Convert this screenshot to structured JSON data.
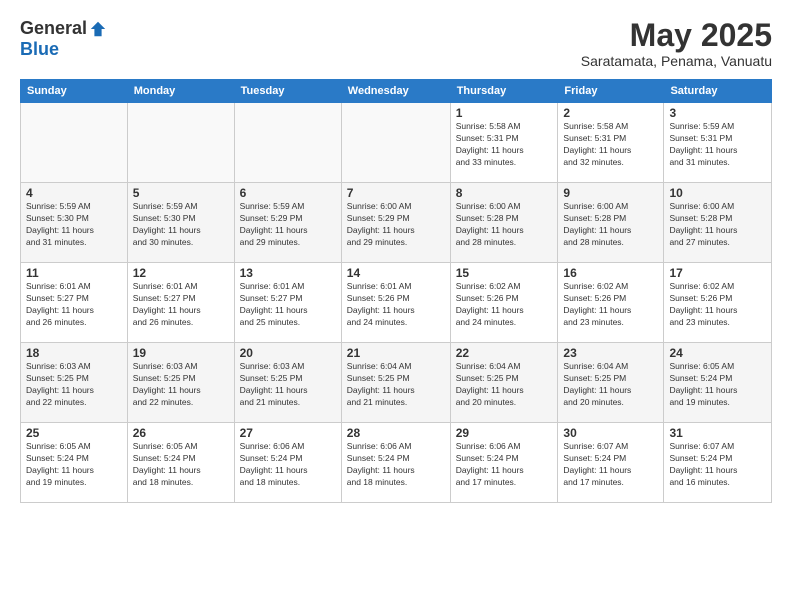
{
  "header": {
    "logo_general": "General",
    "logo_blue": "Blue",
    "month_title": "May 2025",
    "subtitle": "Saratamata, Penama, Vanuatu"
  },
  "days_of_week": [
    "Sunday",
    "Monday",
    "Tuesday",
    "Wednesday",
    "Thursday",
    "Friday",
    "Saturday"
  ],
  "weeks": [
    [
      {
        "day": "",
        "info": ""
      },
      {
        "day": "",
        "info": ""
      },
      {
        "day": "",
        "info": ""
      },
      {
        "day": "",
        "info": ""
      },
      {
        "day": "1",
        "info": "Sunrise: 5:58 AM\nSunset: 5:31 PM\nDaylight: 11 hours\nand 33 minutes."
      },
      {
        "day": "2",
        "info": "Sunrise: 5:58 AM\nSunset: 5:31 PM\nDaylight: 11 hours\nand 32 minutes."
      },
      {
        "day": "3",
        "info": "Sunrise: 5:59 AM\nSunset: 5:31 PM\nDaylight: 11 hours\nand 31 minutes."
      }
    ],
    [
      {
        "day": "4",
        "info": "Sunrise: 5:59 AM\nSunset: 5:30 PM\nDaylight: 11 hours\nand 31 minutes."
      },
      {
        "day": "5",
        "info": "Sunrise: 5:59 AM\nSunset: 5:30 PM\nDaylight: 11 hours\nand 30 minutes."
      },
      {
        "day": "6",
        "info": "Sunrise: 5:59 AM\nSunset: 5:29 PM\nDaylight: 11 hours\nand 29 minutes."
      },
      {
        "day": "7",
        "info": "Sunrise: 6:00 AM\nSunset: 5:29 PM\nDaylight: 11 hours\nand 29 minutes."
      },
      {
        "day": "8",
        "info": "Sunrise: 6:00 AM\nSunset: 5:28 PM\nDaylight: 11 hours\nand 28 minutes."
      },
      {
        "day": "9",
        "info": "Sunrise: 6:00 AM\nSunset: 5:28 PM\nDaylight: 11 hours\nand 28 minutes."
      },
      {
        "day": "10",
        "info": "Sunrise: 6:00 AM\nSunset: 5:28 PM\nDaylight: 11 hours\nand 27 minutes."
      }
    ],
    [
      {
        "day": "11",
        "info": "Sunrise: 6:01 AM\nSunset: 5:27 PM\nDaylight: 11 hours\nand 26 minutes."
      },
      {
        "day": "12",
        "info": "Sunrise: 6:01 AM\nSunset: 5:27 PM\nDaylight: 11 hours\nand 26 minutes."
      },
      {
        "day": "13",
        "info": "Sunrise: 6:01 AM\nSunset: 5:27 PM\nDaylight: 11 hours\nand 25 minutes."
      },
      {
        "day": "14",
        "info": "Sunrise: 6:01 AM\nSunset: 5:26 PM\nDaylight: 11 hours\nand 24 minutes."
      },
      {
        "day": "15",
        "info": "Sunrise: 6:02 AM\nSunset: 5:26 PM\nDaylight: 11 hours\nand 24 minutes."
      },
      {
        "day": "16",
        "info": "Sunrise: 6:02 AM\nSunset: 5:26 PM\nDaylight: 11 hours\nand 23 minutes."
      },
      {
        "day": "17",
        "info": "Sunrise: 6:02 AM\nSunset: 5:26 PM\nDaylight: 11 hours\nand 23 minutes."
      }
    ],
    [
      {
        "day": "18",
        "info": "Sunrise: 6:03 AM\nSunset: 5:25 PM\nDaylight: 11 hours\nand 22 minutes."
      },
      {
        "day": "19",
        "info": "Sunrise: 6:03 AM\nSunset: 5:25 PM\nDaylight: 11 hours\nand 22 minutes."
      },
      {
        "day": "20",
        "info": "Sunrise: 6:03 AM\nSunset: 5:25 PM\nDaylight: 11 hours\nand 21 minutes."
      },
      {
        "day": "21",
        "info": "Sunrise: 6:04 AM\nSunset: 5:25 PM\nDaylight: 11 hours\nand 21 minutes."
      },
      {
        "day": "22",
        "info": "Sunrise: 6:04 AM\nSunset: 5:25 PM\nDaylight: 11 hours\nand 20 minutes."
      },
      {
        "day": "23",
        "info": "Sunrise: 6:04 AM\nSunset: 5:25 PM\nDaylight: 11 hours\nand 20 minutes."
      },
      {
        "day": "24",
        "info": "Sunrise: 6:05 AM\nSunset: 5:24 PM\nDaylight: 11 hours\nand 19 minutes."
      }
    ],
    [
      {
        "day": "25",
        "info": "Sunrise: 6:05 AM\nSunset: 5:24 PM\nDaylight: 11 hours\nand 19 minutes."
      },
      {
        "day": "26",
        "info": "Sunrise: 6:05 AM\nSunset: 5:24 PM\nDaylight: 11 hours\nand 18 minutes."
      },
      {
        "day": "27",
        "info": "Sunrise: 6:06 AM\nSunset: 5:24 PM\nDaylight: 11 hours\nand 18 minutes."
      },
      {
        "day": "28",
        "info": "Sunrise: 6:06 AM\nSunset: 5:24 PM\nDaylight: 11 hours\nand 18 minutes."
      },
      {
        "day": "29",
        "info": "Sunrise: 6:06 AM\nSunset: 5:24 PM\nDaylight: 11 hours\nand 17 minutes."
      },
      {
        "day": "30",
        "info": "Sunrise: 6:07 AM\nSunset: 5:24 PM\nDaylight: 11 hours\nand 17 minutes."
      },
      {
        "day": "31",
        "info": "Sunrise: 6:07 AM\nSunset: 5:24 PM\nDaylight: 11 hours\nand 16 minutes."
      }
    ]
  ]
}
